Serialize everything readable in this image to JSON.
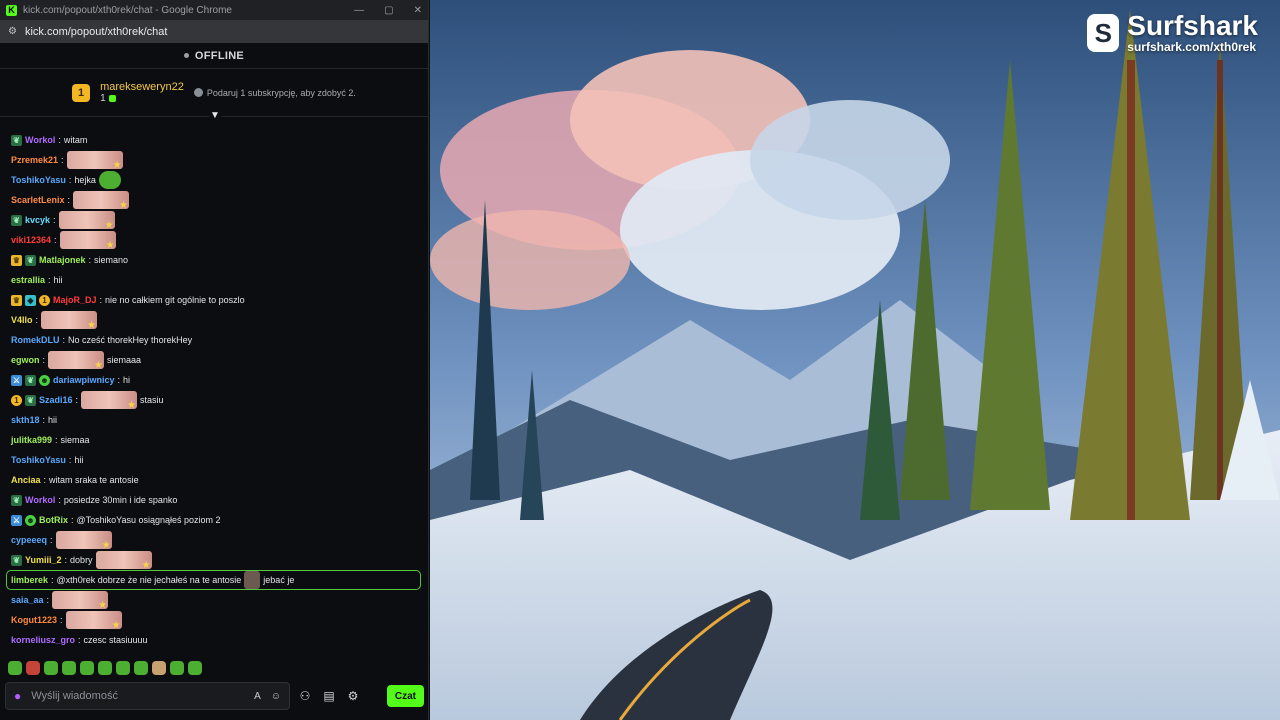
{
  "browser": {
    "window_title": "kick.com/popout/xth0rek/chat - Google Chrome",
    "url": "kick.com/popout/xth0rek/chat"
  },
  "status": {
    "label": "OFFLINE"
  },
  "subscription_banner": {
    "username": "marekseweryn22",
    "badge": "1",
    "count": "1",
    "gift_text": "Podaruj 1 subskrypcję, aby zdobyć 2."
  },
  "colors": {
    "accent": "#53fc18"
  },
  "messages": [
    {
      "badges": [
        "gift"
      ],
      "user": "Workol",
      "color": "#b06cff",
      "text": "witam",
      "emotes": []
    },
    {
      "badges": [],
      "user": "Pzremek21",
      "color": "#ff8a3d",
      "text": "",
      "emotes": [
        "pink"
      ]
    },
    {
      "badges": [],
      "user": "ToshikoYasu",
      "color": "#5aa9ff",
      "text": "hejka",
      "emotes": [
        "green"
      ]
    },
    {
      "badges": [],
      "user": "ScarletLenix",
      "color": "#ff8a3d",
      "text": "",
      "emotes": [
        "pink"
      ]
    },
    {
      "badges": [
        "gift"
      ],
      "user": "kvcyk",
      "color": "#5fe0ff",
      "text": "",
      "emotes": [
        "pink"
      ]
    },
    {
      "badges": [],
      "user": "viki12364",
      "color": "#ff3b3b",
      "text": "",
      "emotes": [
        "pink"
      ]
    },
    {
      "badges": [
        "crown",
        "gift"
      ],
      "user": "Matlajonek",
      "color": "#9ef05a",
      "text": "siemano",
      "emotes": []
    },
    {
      "badges": [],
      "user": "estrallia",
      "color": "#9ef05a",
      "text": "hii",
      "emotes": []
    },
    {
      "badges": [
        "crown",
        "vip",
        "sub"
      ],
      "user": "MajoR_DJ",
      "color": "#ff3b3b",
      "text": "nie no całkiem git ogólnie to poszlo",
      "emotes": []
    },
    {
      "badges": [],
      "user": "V4llo",
      "color": "#f2e14c",
      "text": "",
      "emotes": [
        "pink"
      ]
    },
    {
      "badges": [],
      "user": "RomekDLU",
      "color": "#5aa9ff",
      "text": "No cześć thorekHey thorekHey",
      "emotes": []
    },
    {
      "badges": [],
      "user": "egwon",
      "color": "#9ef05a",
      "text": "siemaaa",
      "emotes": [
        "pink"
      ]
    },
    {
      "badges": [
        "mod",
        "gift",
        "bot"
      ],
      "user": "dariawpiwnicy",
      "color": "#5aa9ff",
      "text": "hi",
      "emotes": []
    },
    {
      "badges": [
        "sub",
        "gift"
      ],
      "user": "Szadi16",
      "color": "#5aa9ff",
      "text": "stasiu",
      "emotes": [
        "pink"
      ]
    },
    {
      "badges": [],
      "user": "skth18",
      "color": "#5aa9ff",
      "text": "hii",
      "emotes": []
    },
    {
      "badges": [],
      "user": "julitka999",
      "color": "#9ef05a",
      "text": "siemaa",
      "emotes": []
    },
    {
      "badges": [],
      "user": "ToshikoYasu",
      "color": "#5aa9ff",
      "text": "hii",
      "emotes": []
    },
    {
      "badges": [],
      "user": "Anciaa",
      "color": "#f2e14c",
      "text": "witam sraka te antosie",
      "emotes": []
    },
    {
      "badges": [
        "gift"
      ],
      "user": "Workol",
      "color": "#b06cff",
      "text": "posiedze 30min i ide spanko",
      "emotes": []
    },
    {
      "badges": [
        "mod",
        "bot"
      ],
      "user": "BotRix",
      "color": "#9ef05a",
      "text": "@ToshikoYasu osiągnąłeś poziom 2",
      "emotes": []
    },
    {
      "badges": [],
      "user": "cypeeeq",
      "color": "#5aa9ff",
      "text": "",
      "emotes": [
        "pink"
      ]
    },
    {
      "badges": [
        "gift"
      ],
      "user": "Yumiii_2",
      "color": "#f2e14c",
      "text": "dobry",
      "emotes": [
        "pink"
      ]
    },
    {
      "badges": [],
      "user": "limberek",
      "color": "#9ef05a",
      "text": "@xth0rek dobrze że nie jechałeś na te antosie",
      "emotes": [
        "face"
      ],
      "after": "jebać je",
      "highlight": true
    },
    {
      "badges": [],
      "user": "saia_aa",
      "color": "#5aa9ff",
      "text": "",
      "emotes": [
        "pink"
      ]
    },
    {
      "badges": [],
      "user": "Kogut1223",
      "color": "#ff8a3d",
      "text": "",
      "emotes": [
        "pink"
      ]
    },
    {
      "badges": [],
      "user": "korneliusz_gro",
      "color": "#b06cff",
      "text": "czesc stasiuuuu",
      "emotes": []
    }
  ],
  "input": {
    "placeholder": "Wyślij wiadomość",
    "send_label": "Czat"
  },
  "sponsor": {
    "brand": "Surfshark",
    "link": "surfshark.com/xth0rek"
  }
}
